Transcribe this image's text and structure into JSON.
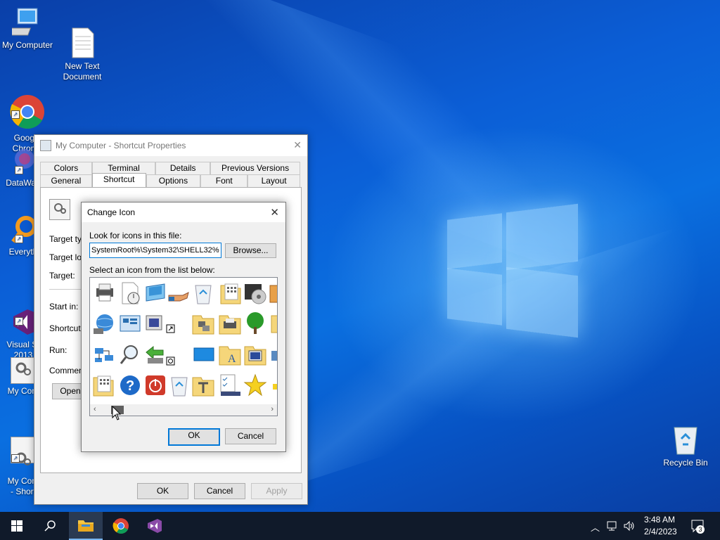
{
  "desktop": {
    "icons": [
      {
        "label": "My Computer",
        "icon": "computer-icon"
      },
      {
        "label": "New Text\nDocument",
        "icon": "text-document-icon"
      },
      {
        "label": "Google\nChrome",
        "icon": "chrome-icon"
      },
      {
        "label": "DataWag",
        "icon": "datawag-icon"
      },
      {
        "label": "Everyth",
        "icon": "everything-search-icon"
      },
      {
        "label": "Visual St\n2013",
        "icon": "visual-studio-icon"
      },
      {
        "label": "My Com",
        "icon": "computer-settings-icon"
      },
      {
        "label": "My Com\n- Short",
        "icon": "computer-settings-icon"
      },
      {
        "label": "Recycle Bin",
        "icon": "recycle-bin-icon"
      }
    ]
  },
  "properties_dialog": {
    "title": "My Computer - Shortcut Properties",
    "tabs_row1": [
      "Colors",
      "Terminal",
      "Details",
      "Previous Versions"
    ],
    "tabs_row2": [
      "General",
      "Shortcut",
      "Options",
      "Font",
      "Layout"
    ],
    "active_tab": "Shortcut",
    "labels": {
      "target_type": "Target typ",
      "target_location": "Target loc",
      "target": "Target:",
      "start_in": "Start in:",
      "shortcut_key": "Shortcut k",
      "run": "Run:",
      "comment": "Comment:"
    },
    "open_button": "Open",
    "ok": "OK",
    "cancel": "Cancel",
    "apply": "Apply"
  },
  "change_icon_dialog": {
    "title": "Change Icon",
    "look_label": "Look for icons in this file:",
    "path_value": "%SystemRoot%\\System32\\SHELL32",
    "browse": "Browse...",
    "select_label": "Select an icon from the list below:",
    "icons": [
      "printer-icon",
      "document-clock-icon",
      "monitor-icon",
      "hand-share-icon",
      "recycle-bin-full-icon",
      "folder-grid-icon",
      "media-player-icon",
      "orange-partial-icon",
      "globe-network-icon",
      "control-panel-icon",
      "display-properties-icon",
      "shortcut-overlay-icon",
      "",
      "folder-network-icon",
      "folder-printer-icon",
      "tree-icon",
      "yellow-partial-icon",
      "network-icon",
      "magnifier-search-icon",
      "go-back-icon",
      "shortcut-clock-icon",
      "",
      "blue-rectangle-icon",
      "folder-font-icon",
      "folder-computer-icon",
      "blue-partial-icon",
      "folder-grid-icon",
      "help-icon",
      "power-icon",
      "recycle-bin-empty-icon",
      "",
      "folder-tools-icon",
      "checklist-icon",
      "star-icon",
      "small-partial-icon"
    ],
    "ok": "OK",
    "cancel": "Cancel"
  },
  "taskbar": {
    "items": [
      "start-icon",
      "search-icon",
      "file-explorer-icon",
      "chrome-icon",
      "visual-studio-icon"
    ],
    "time": "3:48 AM",
    "date": "2/4/2023",
    "notification_count": "3"
  }
}
